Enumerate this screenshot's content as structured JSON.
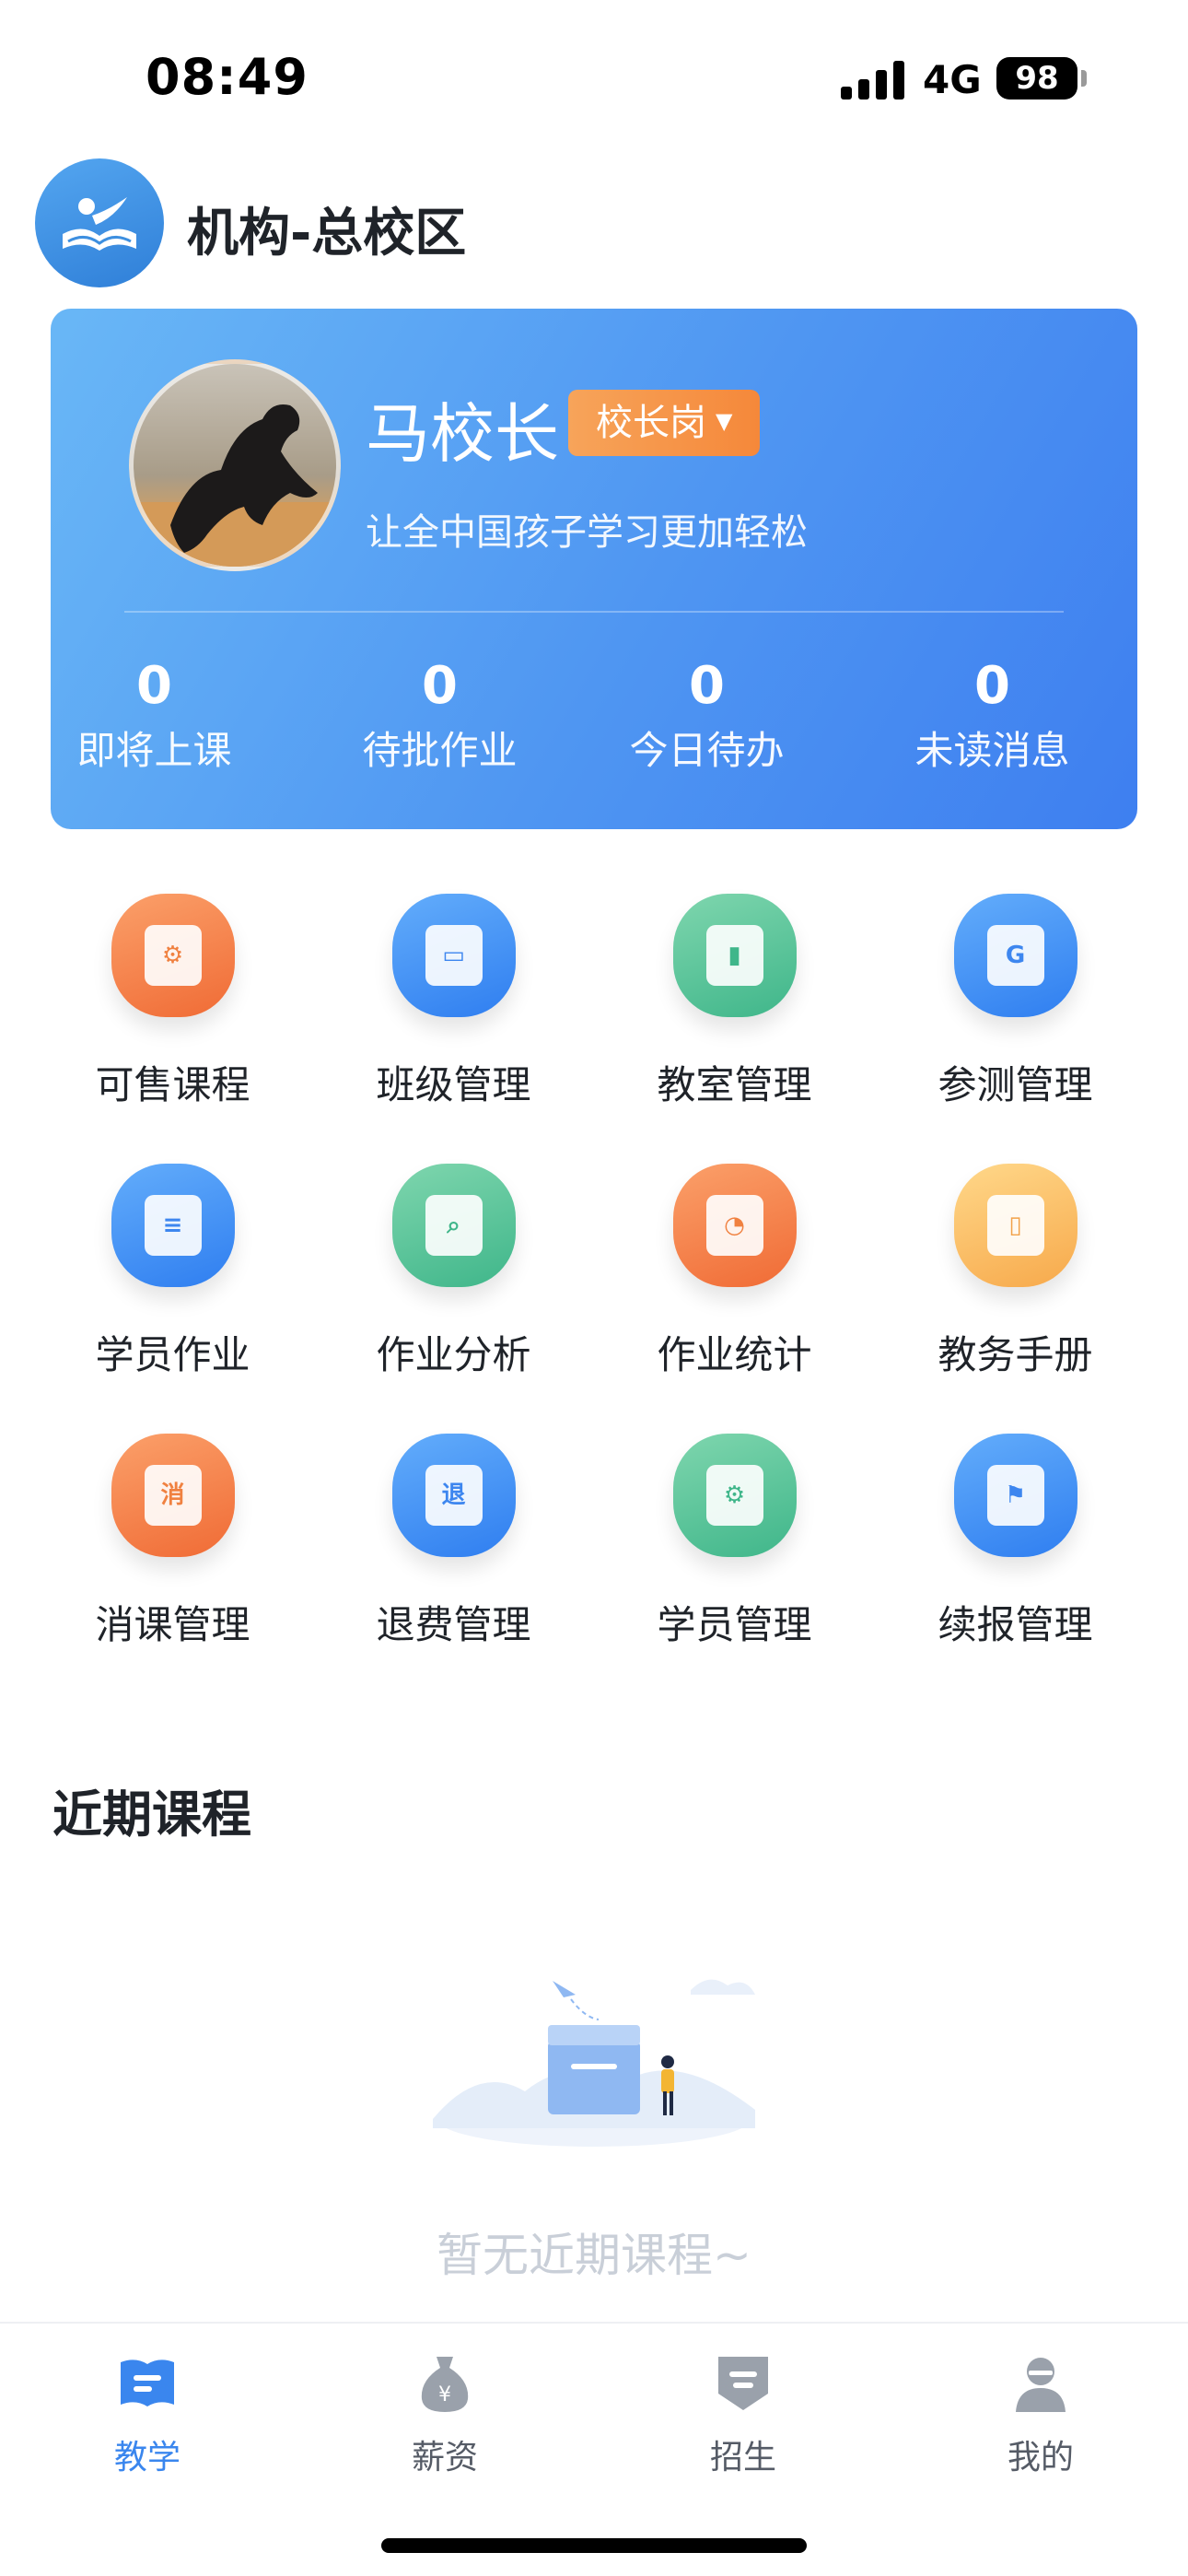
{
  "status_bar": {
    "time": "08:49",
    "network": "4G",
    "battery": "98"
  },
  "header": {
    "org_title": "机构-总校区",
    "logo_icon": "book-logo-icon"
  },
  "profile": {
    "name": "马校长",
    "role": "校长岗",
    "slogan": "让全中国孩子学习更加轻松",
    "stats": [
      {
        "value": "0",
        "label": "即将上课"
      },
      {
        "value": "0",
        "label": "待批作业"
      },
      {
        "value": "0",
        "label": "今日待办"
      },
      {
        "value": "0",
        "label": "未读消息"
      }
    ]
  },
  "grid": [
    {
      "label": "可售课程",
      "icon": "course-gear-icon",
      "color": "orange",
      "glyph": "⚙"
    },
    {
      "label": "班级管理",
      "icon": "class-box-icon",
      "color": "blue",
      "glyph": "▭"
    },
    {
      "label": "教室管理",
      "icon": "classroom-book-icon",
      "color": "green",
      "glyph": "▮"
    },
    {
      "label": "参测管理",
      "icon": "test-g-icon",
      "color": "blue",
      "glyph": "G"
    },
    {
      "label": "学员作业",
      "icon": "homework-doc-icon",
      "color": "blue",
      "glyph": "≡"
    },
    {
      "label": "作业分析",
      "icon": "analysis-search-icon",
      "color": "green",
      "glyph": "⌕"
    },
    {
      "label": "作业统计",
      "icon": "statistics-pie-icon",
      "color": "orange",
      "glyph": "◔"
    },
    {
      "label": "教务手册",
      "icon": "manual-bookmark-icon",
      "color": "yellow",
      "glyph": "▯"
    },
    {
      "label": "消课管理",
      "icon": "consume-class-icon",
      "color": "orange",
      "glyph": "消"
    },
    {
      "label": "退费管理",
      "icon": "refund-icon",
      "color": "blue",
      "glyph": "退"
    },
    {
      "label": "学员管理",
      "icon": "student-shield-icon",
      "color": "green",
      "glyph": "⚙"
    },
    {
      "label": "续报管理",
      "icon": "renewal-flag-icon",
      "color": "blue",
      "glyph": "⚑"
    }
  ],
  "recent": {
    "title": "近期课程",
    "empty_text": "暂无近期课程~"
  },
  "tabs": [
    {
      "label": "教学",
      "icon": "teaching-book-icon",
      "active": true
    },
    {
      "label": "薪资",
      "icon": "salary-moneybag-icon",
      "active": false
    },
    {
      "label": "招生",
      "icon": "enrollment-badge-icon",
      "active": false
    },
    {
      "label": "我的",
      "icon": "profile-person-icon",
      "active": false
    }
  ],
  "colors": {
    "accent": "#3a86ee",
    "badge": "#f5883a",
    "card_start": "#69b7f6",
    "card_end": "#3e7ff0"
  }
}
